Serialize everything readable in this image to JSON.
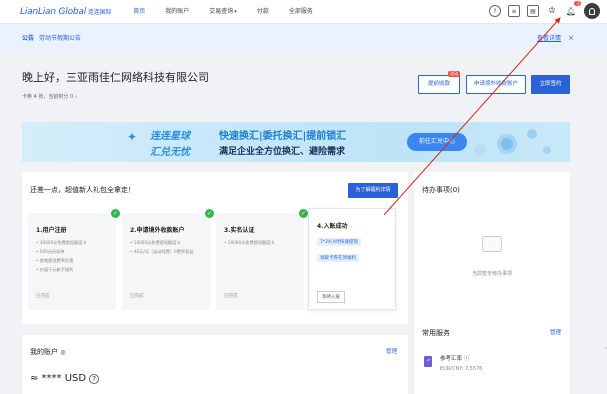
{
  "header": {
    "logo_text": "LianLian Global",
    "logo_cn": "连连国际",
    "nav": [
      {
        "label": "首页",
        "active": true
      },
      {
        "label": "我的账户",
        "active": false
      },
      {
        "label": "交易查询",
        "active": false,
        "dropdown": true
      },
      {
        "label": "付款",
        "active": false
      },
      {
        "label": "全部服务",
        "active": false
      }
    ],
    "icons": [
      "help-icon",
      "document-icon",
      "clipboard-icon",
      "crown-icon",
      "bell-icon"
    ],
    "bell_count": "3"
  },
  "notice": {
    "label": "公告",
    "text": "劳动节假期公告",
    "more": "查看详情",
    "close": "×"
  },
  "welcome": {
    "greeting": "晚上好，三亚雨佳仁网络科技有限公司",
    "sub": "卡券 4 张，当前积分 0 ›",
    "btn_withdraw": "提前收款",
    "btn_withdraw_badge": "活动",
    "btn_open_account": "申请境外收款账户",
    "btn_sign": "立即签约"
  },
  "banner": {
    "slogan1": "连连星球",
    "slogan2": "汇兑无忧",
    "line1": "快速换汇|委托换汇|提前锁汇",
    "line2": "满足企业全方位换汇、避险需求",
    "cta": "前往汇兑中心"
  },
  "steps": {
    "title": "还差一点，超值新人礼包全拿走！",
    "learn_more": "为了解福利详情",
    "items": [
      {
        "title": "1.用户注册",
        "lines": [
          "• 30000元免费提现额度卡",
          "• 500元折扣券",
          "• 首笔提现费率优惠",
          "• 价值千元新手福利"
        ],
        "status": "已完成"
      },
      {
        "title": "2.申请境外收款账户",
        "lines": [
          "• 10000元免费提现额度卡",
          "• 40元/月（自动续费）0费率权益"
        ],
        "status": "已完成"
      },
      {
        "title": "3.实名认证",
        "lines": [
          "• 10000元免费提现额度卡"
        ],
        "status": "已完成"
      },
      {
        "title": "4.入账成功",
        "tags": [
          "7*24小时快速提现",
          "领取卡券在领福利"
        ],
        "status": "等待入账"
      }
    ]
  },
  "todo": {
    "title": "待办事项(0)",
    "empty": "当前暂无待办事项"
  },
  "account": {
    "title": "我的账户",
    "manage": "管理",
    "balance": "≈ **** USD"
  },
  "services": {
    "title": "常用服务",
    "manage": "管理",
    "rate_label": "参考汇率",
    "rate_value": "EUR/CNY: 7.5576"
  }
}
